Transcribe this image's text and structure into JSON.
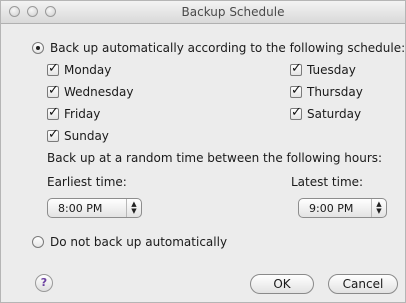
{
  "window": {
    "title": "Backup Schedule"
  },
  "schedule": {
    "auto_label": "Back up automatically according to the following schedule:",
    "auto_selected": true,
    "days": [
      {
        "label": "Monday",
        "checked": true
      },
      {
        "label": "Tuesday",
        "checked": true
      },
      {
        "label": "Wednesday",
        "checked": true
      },
      {
        "label": "Thursday",
        "checked": true
      },
      {
        "label": "Friday",
        "checked": true
      },
      {
        "label": "Saturday",
        "checked": true
      },
      {
        "label": "Sunday",
        "checked": true
      }
    ],
    "random_time_label": "Back up at a random time between the following hours:",
    "earliest_label": "Earliest time:",
    "latest_label": "Latest time:",
    "earliest_value": "8:00 PM",
    "latest_value": "9:00 PM"
  },
  "manual": {
    "label": "Do not back up automatically",
    "selected": false
  },
  "buttons": {
    "help": "?",
    "ok": "OK",
    "cancel": "Cancel"
  }
}
